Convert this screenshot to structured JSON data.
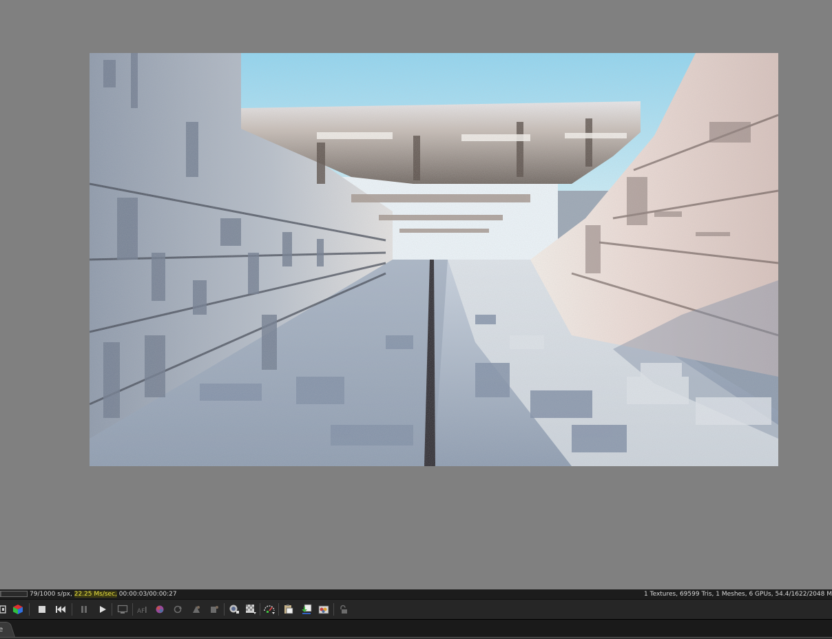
{
  "status": {
    "samples": "79/1000 s/px, ",
    "speed": "22.25 Ms/sec,",
    "time": " 00:00:03/00:00:27",
    "scene_info": "1 Textures, 69599 Tris, 1 Meshes, 6 GPUs, 54.4/1622/2048 M",
    "progress_fraction": 0.079
  },
  "toolbar": {
    "icons": [
      "settings-icon",
      "color-cube-icon",
      "stop-icon",
      "restart-icon",
      "pause-icon",
      "play-icon",
      "render-region-icon",
      "autofocus-icon",
      "color-picker-icon",
      "refresh-icon",
      "material-picker-icon",
      "object-picker-icon",
      "lock-view-icon",
      "clay-mode-icon",
      "sub-sampling-icon",
      "copy-icon",
      "save-icon",
      "channels-icon",
      "lock-icon"
    ]
  },
  "tab": {
    "label": "ne"
  },
  "colors": {
    "viewport_bg": "#808080",
    "highlight": "#e8e040",
    "toolbar_bg": "#262626"
  }
}
